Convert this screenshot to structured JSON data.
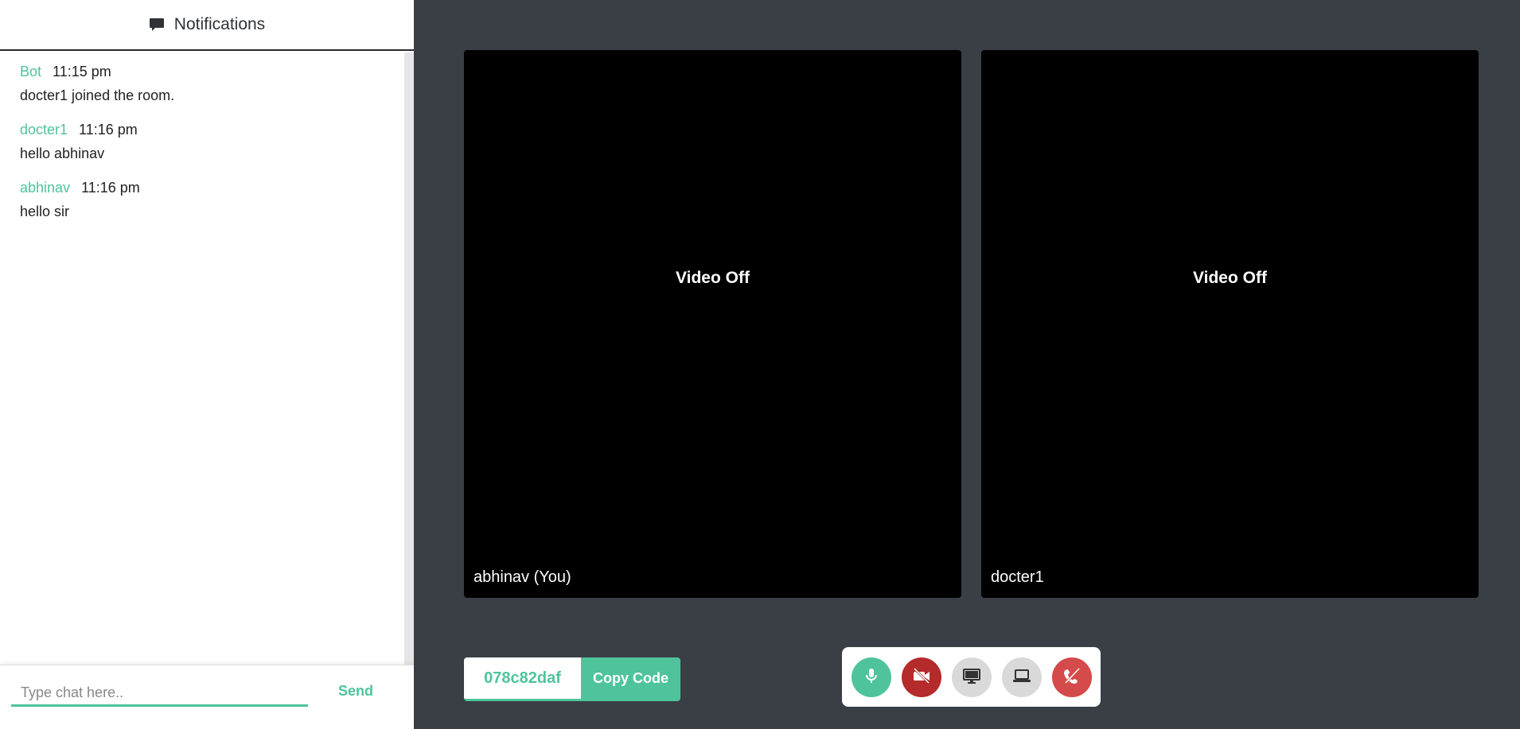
{
  "sidebar": {
    "title": "Notifications",
    "messages": [
      {
        "author": "Bot",
        "time": "11:15 pm",
        "text": "docter1 joined the room."
      },
      {
        "author": "docter1",
        "time": "11:16 pm",
        "text": "hello abhinav"
      },
      {
        "author": "abhinav",
        "time": "11:16 pm",
        "text": "hello sir"
      }
    ],
    "chat_placeholder": "Type chat here..",
    "send_label": "Send"
  },
  "videos": [
    {
      "status": "Video Off",
      "name": "abhinav (You)"
    },
    {
      "status": "Video Off",
      "name": "docter1"
    }
  ],
  "room": {
    "code": "078c82daf",
    "copy_label": "Copy Code"
  },
  "controls": {
    "icons": [
      "microphone-icon",
      "video-off-icon",
      "monitor-icon",
      "laptop-icon",
      "hang-up-icon"
    ]
  },
  "colors": {
    "accent": "#4fc49c",
    "background": "#3a3e45",
    "video_off_button": "#b52a2a",
    "hang_up_button": "#d54a4a"
  }
}
